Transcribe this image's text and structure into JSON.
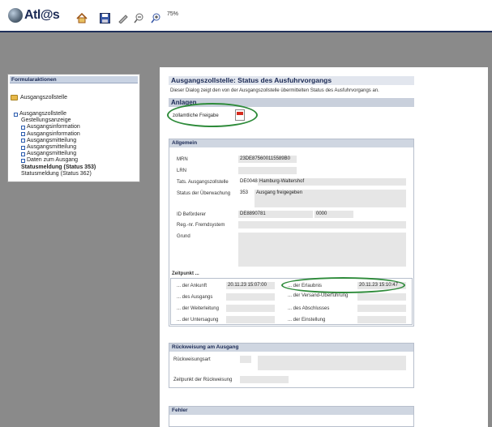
{
  "toolbar": {
    "logo_text": "Atl@s",
    "zoom": "75%"
  },
  "sidebar": {
    "title": "Formularaktionen",
    "root": "Ausgangszollstelle",
    "tree": [
      {
        "label": "Ausgangszollstelle",
        "box": true,
        "level": 0,
        "bold": false
      },
      {
        "label": "Gestellungsanzeige",
        "box": false,
        "level": 1,
        "bold": false
      },
      {
        "label": "Ausgangsinformation",
        "box": true,
        "level": 1,
        "bold": false
      },
      {
        "label": "Ausgangsinformation",
        "box": true,
        "level": 1,
        "bold": false
      },
      {
        "label": "Ausgangsmitteilung",
        "box": true,
        "level": 1,
        "bold": false
      },
      {
        "label": "Ausgangsmitteilung",
        "box": true,
        "level": 1,
        "bold": false
      },
      {
        "label": "Ausgangsmitteilung",
        "box": true,
        "level": 1,
        "bold": false
      },
      {
        "label": "Daten zum Ausgang",
        "box": true,
        "level": 1,
        "bold": false
      },
      {
        "label": "Statusmeldung (Status 353)",
        "box": false,
        "level": 1,
        "bold": true
      },
      {
        "label": "Statusmeldung (Status 362)",
        "box": false,
        "level": 1,
        "bold": false
      }
    ]
  },
  "main": {
    "title": "Ausgangszollstelle: Status des Ausfuhrvorgangs",
    "description": "Dieser Dialog zeigt den von der Ausgangszollstelle übermittelten Status des Ausfuhrvorgangs an.",
    "anlagen": {
      "heading": "Anlagen",
      "item": "zollamtliche Freigabe"
    },
    "allgemein": {
      "heading": "Allgemein",
      "mrn_label": "MRN",
      "mrn": "23DE875600115589B0",
      "lrn_label": "LRN",
      "tats_label": "Tats. Ausgangszollstelle",
      "tats_code": "DE004851",
      "tats_name": "Hamburg-Waltershof",
      "status_label": "Status der Überwachung",
      "status_code": "353",
      "status_text": "Ausgang freigegeben",
      "befoerderer_label": "ID Beförderer",
      "befoerderer": "DE8890781",
      "befoerderer_nr": "0000",
      "regnr_label": "Reg.-nr. Fremdsystem",
      "grund_label": "Grund"
    },
    "zeitpunkt": {
      "heading": "Zeitpunkt ...",
      "ankunft_label": "... der Ankunft",
      "ankunft": "20.11.23 15:07:00",
      "erlaubnis_label": "... der Erlaubnis",
      "erlaubnis": "20.11.23 15:10:47",
      "ausgang_label": "... des Ausgangs",
      "versand_label": "... der Versand-Überführung",
      "weiterleitung_label": "... der Weiterleitung",
      "abschluss_label": "... des Abschlusses",
      "untersagung_label": "... der Untersagung",
      "einstellung_label": "... der Einstellung"
    },
    "rueckweisung": {
      "heading": "Rückweisung am Ausgang",
      "art_label": "Rückweisungsart",
      "zeit_label": "Zeitpunkt der Rückweisung"
    },
    "fehler": {
      "heading": "Fehler"
    }
  },
  "colors": {
    "accent": "#1b2a55",
    "highlight": "#2e8b3a"
  }
}
